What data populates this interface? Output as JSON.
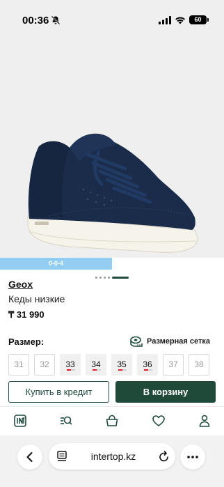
{
  "status_bar": {
    "time": "00:36",
    "battery": "60",
    "icons": [
      "bell-off-icon",
      "signal-icon",
      "wifi-icon",
      "battery-icon"
    ]
  },
  "gallery": {
    "image": "navy-low-sneaker",
    "slide_count": 5,
    "active_slide": 5
  },
  "promo_badge": "0-0-4",
  "product": {
    "brand": "Geox",
    "title": "Кеды низкие",
    "price": "₸ 31 990"
  },
  "size_section": {
    "label": "Размер:",
    "size_chart_label": "Размерная сетка",
    "sizes": [
      {
        "label": "31",
        "available": false,
        "low_stock": false
      },
      {
        "label": "32",
        "available": false,
        "low_stock": false
      },
      {
        "label": "33",
        "available": true,
        "low_stock": true
      },
      {
        "label": "34",
        "available": true,
        "low_stock": true
      },
      {
        "label": "35",
        "available": true,
        "low_stock": true
      },
      {
        "label": "36",
        "available": true,
        "low_stock": true
      },
      {
        "label": "37",
        "available": false,
        "low_stock": false
      },
      {
        "label": "38",
        "available": false,
        "low_stock": false
      }
    ]
  },
  "actions": {
    "credit_label": "Купить в кредит",
    "cart_label": "В корзину"
  },
  "tab_bar": {
    "items": [
      "intertop-logo-icon",
      "catalog-search-icon",
      "bag-icon",
      "heart-icon",
      "profile-icon"
    ]
  },
  "browser": {
    "url": "intertop.kz"
  },
  "colors": {
    "accent": "#1f4a3a",
    "badge": "#93cdf1",
    "low_stock": "#e21b2a",
    "image_bg": "#efefef"
  }
}
